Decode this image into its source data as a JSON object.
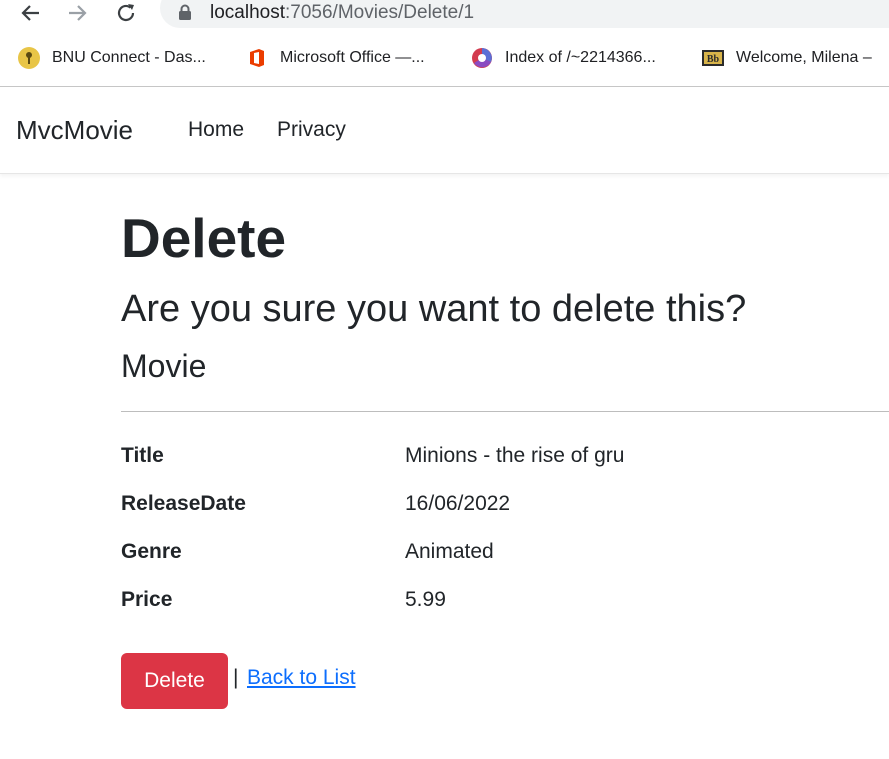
{
  "browser": {
    "url_host": "localhost",
    "url_path": ":7056/Movies/Delete/1",
    "bookmarks": [
      {
        "label": "BNU Connect - Das...",
        "icon": "key-icon"
      },
      {
        "label": "Microsoft Office —...",
        "icon": "office-icon"
      },
      {
        "label": "Index of /~2214366...",
        "icon": "chrome-circle-icon"
      },
      {
        "label": "Welcome, Milena –",
        "icon": "blackboard-icon"
      }
    ]
  },
  "navbar": {
    "brand": "MvcMovie",
    "links": [
      "Home",
      "Privacy"
    ]
  },
  "page": {
    "title": "Delete",
    "confirm": "Are you sure you want to delete this?",
    "entity": "Movie",
    "fields": [
      {
        "label": "Title",
        "value": "Minions - the rise of gru"
      },
      {
        "label": "ReleaseDate",
        "value": "16/06/2022"
      },
      {
        "label": "Genre",
        "value": "Animated"
      },
      {
        "label": "Price",
        "value": "5.99"
      }
    ],
    "delete_label": "Delete",
    "separator": "|",
    "back_label": "Back to List"
  },
  "colors": {
    "danger": "#dc3545",
    "link": "#0d6efd",
    "text": "#212529"
  }
}
